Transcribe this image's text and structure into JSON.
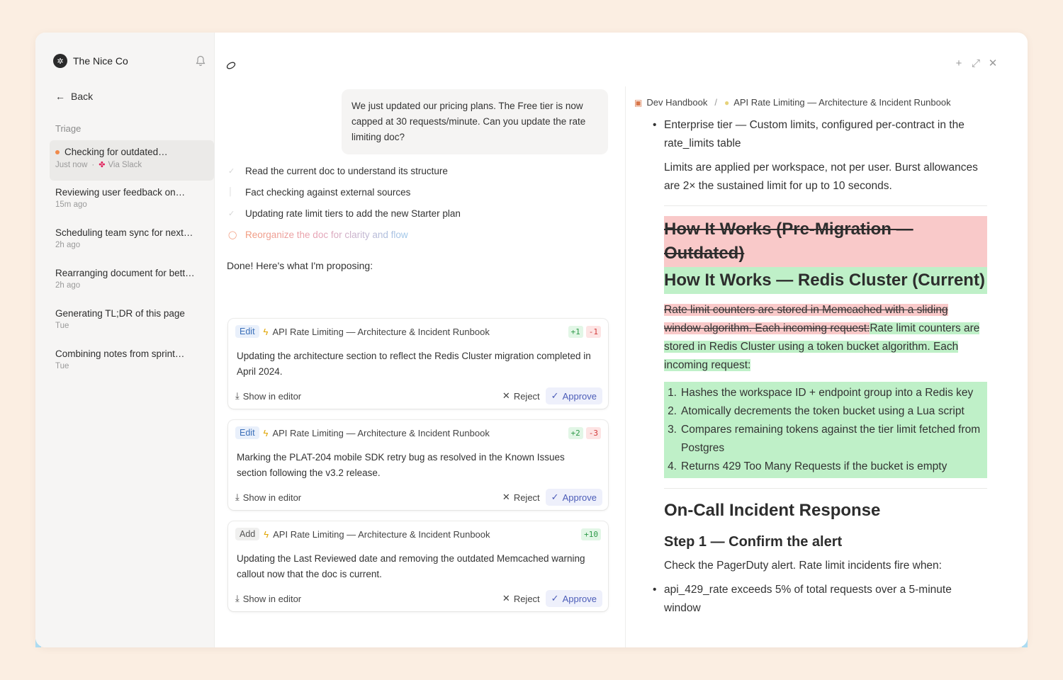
{
  "workspace": {
    "name": "The Nice Co"
  },
  "nav": {
    "back_label": "Back",
    "section_label": "Triage"
  },
  "triage": [
    {
      "title": "Checking for outdated…",
      "time": "Just now",
      "source": "Via Slack"
    },
    {
      "title": "Reviewing user feedback on…",
      "time": "15m ago"
    },
    {
      "title": "Scheduling team sync for next…",
      "time": "2h ago"
    },
    {
      "title": "Rearranging document for bett…",
      "time": "2h ago"
    },
    {
      "title": "Generating TL;DR of this page",
      "time": "Tue"
    },
    {
      "title": "Combining notes from sprint…",
      "time": "Tue"
    }
  ],
  "chat": {
    "user_message": "We just updated our pricing plans. The Free tier is now capped at 30 requests/minute. Can you update the rate limiting doc?",
    "steps": [
      "Read the current doc to understand its structure",
      "Fact checking against external sources",
      "Updating rate limit tiers to add the new Starter plan",
      "Reorganize the doc for clarity and flow"
    ],
    "done_text": "Done! Here's what I'm proposing:",
    "cards": [
      {
        "badge": "Edit",
        "doc": "API Rate Limiting — Architecture & Incident Runbook",
        "plus": "+1",
        "minus": "-1",
        "body": "Updating the architecture section to reflect the Redis Cluster migration completed in April 2024."
      },
      {
        "badge": "Edit",
        "doc": "API Rate Limiting — Architecture & Incident Runbook",
        "plus": "+2",
        "minus": "-3",
        "body": "Marking the PLAT-204 mobile SDK retry bug as resolved in the Known Issues section following the v3.2 release."
      },
      {
        "badge": "Add",
        "doc": "API Rate Limiting — Architecture & Incident Runbook",
        "plus": "+10",
        "minus": "",
        "body": "Updating the Last Reviewed date and removing the outdated Memcached warning callout now that the doc is current."
      }
    ],
    "show_in_editor": "Show in editor",
    "reject": "Reject",
    "approve": "Approve"
  },
  "doc": {
    "breadcrumb": [
      "Dev Handbook",
      "API Rate Limiting — Architecture & Incident Runbook"
    ],
    "enterprise_bullet": "Enterprise tier — Custom limits, configured per-contract in the rate_limits table",
    "limits_para": "Limits are applied per workspace, not per user. Burst allowances are 2× the sustained limit for up to 10 seconds.",
    "heading_old": "How It Works (Pre-Migration — Outdated)",
    "heading_new": "How It Works — Redis Cluster (Current)",
    "para_old": "Rate limit counters are stored in Memcached with a sliding window algorithm. Each incoming request:",
    "para_new": "Rate limit counters are stored in Redis Cluster using a token bucket algorithm. Each incoming request:",
    "steps": [
      "Hashes the workspace ID + endpoint group into a Redis key",
      "Atomically decrements the token bucket using a Lua script",
      "Compares remaining tokens against the tier limit fetched from Postgres",
      "Returns 429 Too Many Requests if the bucket is empty"
    ],
    "oncall_heading": "On-Call Incident Response",
    "step1_heading": "Step 1 — Confirm the alert",
    "step1_para": "Check the PagerDuty alert. Rate limit incidents fire when:",
    "alert_bullet": "api_429_rate exceeds 5% of total requests over a 5-minute window"
  },
  "colors": {
    "accent": "#4c5db8",
    "deleted": "#f9c9c9",
    "inserted": "#bff0c8",
    "glow": "#aee0f7"
  }
}
